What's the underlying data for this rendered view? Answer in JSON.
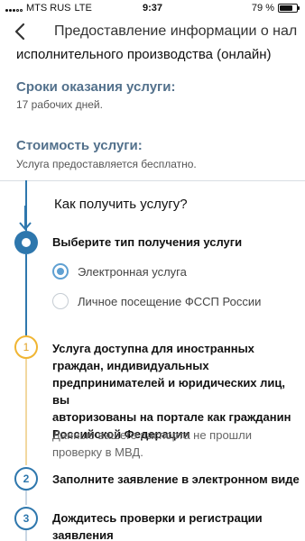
{
  "status_bar": {
    "carrier": "MTS RUS",
    "network": "LTE",
    "time": "9:37",
    "battery": "79 %",
    "battery_level": 0.79
  },
  "nav": {
    "title": "Предоставление информации о нали…"
  },
  "subtitle": "исполнительного производства (онлайн)",
  "term": {
    "title": "Сроки оказания услуги:",
    "text": "17 рабочих дней."
  },
  "cost": {
    "title": "Стоимость услуги:",
    "text": "Услуга предоставляется бесплатно."
  },
  "how": {
    "title": "Как получить услугу?"
  },
  "steps": {
    "choose": {
      "title": "Выберите тип получения услуги",
      "options": [
        {
          "label": "Электронная услуга",
          "selected": true
        },
        {
          "label": "Личное посещение ФССП России",
          "selected": false
        }
      ]
    },
    "warning": {
      "number": "1",
      "title_lines": [
        "Услуга доступна для иностранных",
        "граждан, индивидуальных",
        "предпринимателей и юридических лиц, вы",
        "авторизованы на портале как гражданин",
        "Российской Федерации"
      ],
      "note_lines": [
        "Данные вашего паспорта не прошли",
        "проверку в МВД."
      ]
    },
    "fill": {
      "number": "2",
      "title": "Заполните заявление в электронном виде"
    },
    "wait": {
      "number": "3",
      "title_lines": [
        "Дождитесь проверки и регистрации",
        "заявления"
      ]
    }
  },
  "colors": {
    "accent": "#2e77ad",
    "section_title": "#53718c",
    "warning": "#f0b533"
  }
}
